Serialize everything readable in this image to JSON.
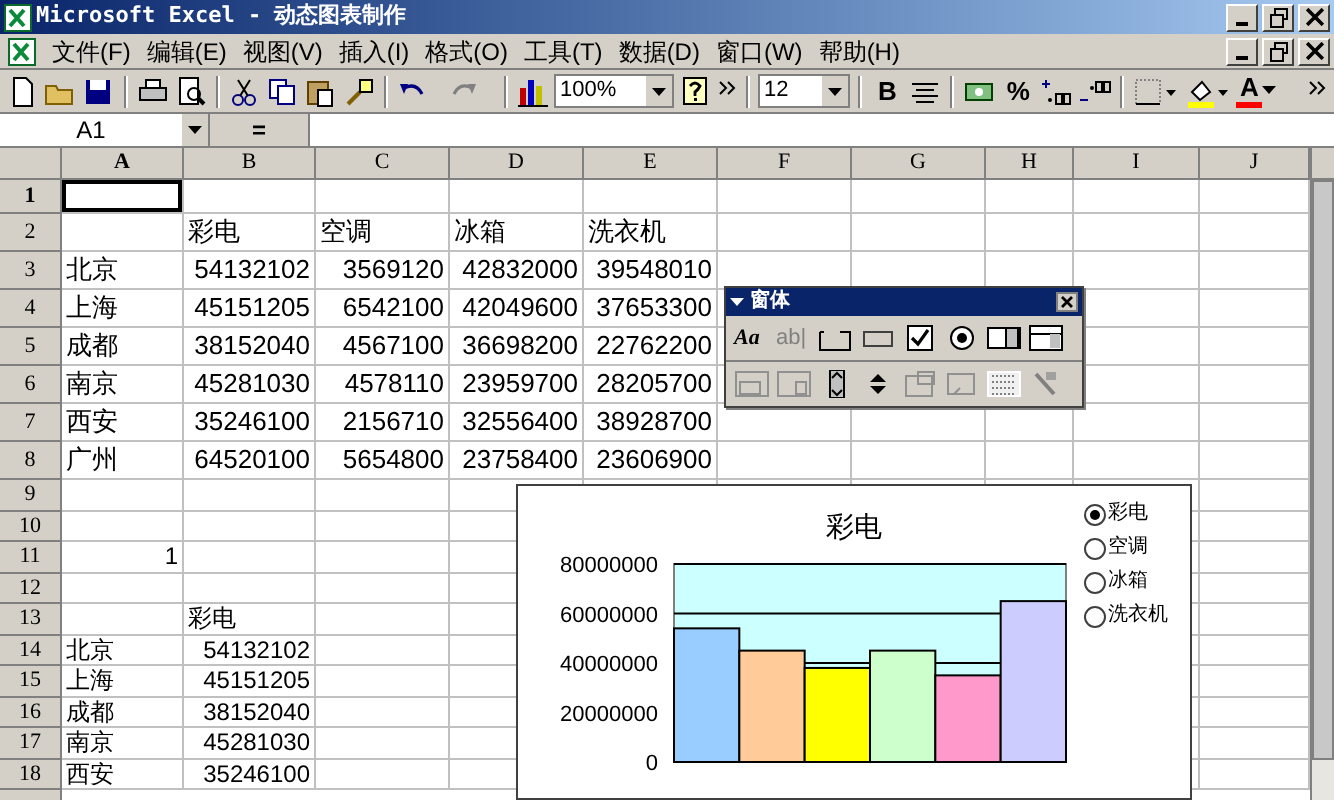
{
  "window": {
    "title": "Microsoft Excel - 动态图表制作"
  },
  "menu": [
    "文件(F)",
    "编辑(E)",
    "视图(V)",
    "插入(I)",
    "格式(O)",
    "工具(T)",
    "数据(D)",
    "窗口(W)",
    "帮助(H)"
  ],
  "toolbar": {
    "zoom": "100%",
    "font_size": "12",
    "bold": "B",
    "percent": "%",
    "font_color": "A"
  },
  "formula_bar": {
    "name_box": "A1",
    "equals": "="
  },
  "columns": [
    "A",
    "B",
    "C",
    "D",
    "E",
    "F",
    "G",
    "H",
    "I",
    "J"
  ],
  "rows": [
    {
      "header": "1",
      "cells": [
        {
          "kind": "empty",
          "selected": true
        }
      ]
    },
    {
      "header": "2",
      "cells": [
        null,
        {
          "text": "彩电",
          "kind": "text"
        },
        {
          "text": "空调",
          "kind": "text"
        },
        {
          "text": "冰箱",
          "kind": "text"
        },
        {
          "text": "洗衣机",
          "kind": "text"
        }
      ]
    },
    {
      "header": "3",
      "cells": [
        {
          "text": "北京",
          "kind": "text"
        },
        {
          "text": "54132102",
          "kind": "number"
        },
        {
          "text": "3569120",
          "kind": "number"
        },
        {
          "text": "42832000",
          "kind": "number"
        },
        {
          "text": "39548010",
          "kind": "number"
        }
      ]
    },
    {
      "header": "4",
      "cells": [
        {
          "text": "上海",
          "kind": "text"
        },
        {
          "text": "45151205",
          "kind": "number"
        },
        {
          "text": "6542100",
          "kind": "number"
        },
        {
          "text": "42049600",
          "kind": "number"
        },
        {
          "text": "37653300",
          "kind": "number"
        }
      ]
    },
    {
      "header": "5",
      "cells": [
        {
          "text": "成都",
          "kind": "text"
        },
        {
          "text": "38152040",
          "kind": "number"
        },
        {
          "text": "4567100",
          "kind": "number"
        },
        {
          "text": "36698200",
          "kind": "number"
        },
        {
          "text": "22762200",
          "kind": "number"
        }
      ]
    },
    {
      "header": "6",
      "cells": [
        {
          "text": "南京",
          "kind": "text"
        },
        {
          "text": "45281030",
          "kind": "number"
        },
        {
          "text": "4578110",
          "kind": "number"
        },
        {
          "text": "23959700",
          "kind": "number"
        },
        {
          "text": "28205700",
          "kind": "number"
        }
      ]
    },
    {
      "header": "7",
      "cells": [
        {
          "text": "西安",
          "kind": "text"
        },
        {
          "text": "35246100",
          "kind": "number"
        },
        {
          "text": "2156710",
          "kind": "number"
        },
        {
          "text": "32556400",
          "kind": "number"
        },
        {
          "text": "38928700",
          "kind": "number"
        }
      ]
    },
    {
      "header": "8",
      "cells": [
        {
          "text": "广州",
          "kind": "text"
        },
        {
          "text": "64520100",
          "kind": "number"
        },
        {
          "text": "5654800",
          "kind": "number"
        },
        {
          "text": "23758400",
          "kind": "number"
        },
        {
          "text": "23606900",
          "kind": "number"
        }
      ]
    },
    {
      "header": "9"
    },
    {
      "header": "10"
    },
    {
      "header": "11",
      "cells": [
        {
          "text": "1",
          "kind": "number"
        }
      ]
    },
    {
      "header": "12"
    },
    {
      "header": "13",
      "cells": [
        null,
        {
          "text": "彩电",
          "kind": "text"
        }
      ]
    },
    {
      "header": "14",
      "cells": [
        {
          "text": "北京",
          "kind": "text"
        },
        {
          "text": "54132102",
          "kind": "number"
        }
      ]
    },
    {
      "header": "15",
      "cells": [
        {
          "text": "上海",
          "kind": "text"
        },
        {
          "text": "45151205",
          "kind": "number"
        }
      ]
    },
    {
      "header": "16",
      "cells": [
        {
          "text": "成都",
          "kind": "text"
        },
        {
          "text": "38152040",
          "kind": "number"
        }
      ]
    },
    {
      "header": "17",
      "cells": [
        {
          "text": "南京",
          "kind": "text"
        },
        {
          "text": "45281030",
          "kind": "number"
        }
      ]
    },
    {
      "header": "18",
      "cells": [
        {
          "text": "西安",
          "kind": "text"
        },
        {
          "text": "35246100",
          "kind": "number"
        }
      ]
    }
  ],
  "forms_toolbar": {
    "title": "窗体",
    "tool_glyphs": [
      "Aa",
      "ab|"
    ]
  },
  "chart": {
    "bars": [
      {
        "color": "#99ccff"
      },
      {
        "color": "#ffcc99"
      },
      {
        "color": "#ffff00"
      },
      {
        "color": "#ccffcc"
      },
      {
        "color": "#ff99cc"
      },
      {
        "color": "#ccccff"
      }
    ],
    "legend": [
      {
        "label": "彩电",
        "selected": true
      },
      {
        "label": "空调",
        "selected": false
      },
      {
        "label": "冰箱",
        "selected": false
      },
      {
        "label": "洗衣机",
        "selected": false
      }
    ],
    "chart_data": {
      "type": "bar",
      "title": "彩电",
      "ylim": [
        0,
        80000000
      ],
      "yticks": [
        0,
        20000000,
        40000000,
        60000000,
        80000000
      ],
      "series": [
        {
          "values": [
            54000000,
            45000000,
            38000000,
            45000000,
            35000000,
            65000000
          ]
        }
      ]
    }
  }
}
